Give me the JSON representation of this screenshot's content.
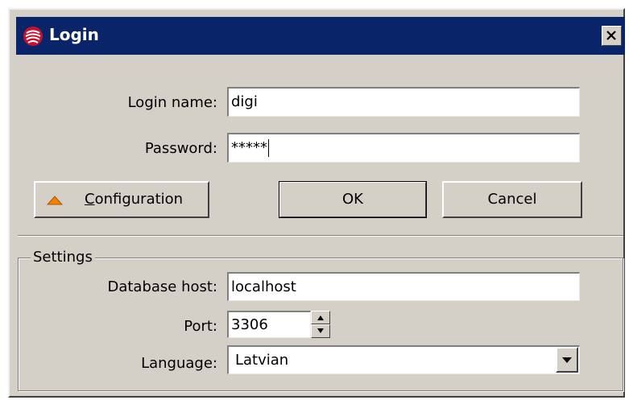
{
  "window": {
    "title": "Login",
    "close_symbol": "✕"
  },
  "login": {
    "login_name_label": "Login name:",
    "login_name_value": "digi",
    "password_label": "Password:",
    "password_value": "*****"
  },
  "buttons": {
    "configuration_prefix": "",
    "configuration_hotkey": "C",
    "configuration_rest": "onfiguration",
    "ok": "OK",
    "cancel": "Cancel"
  },
  "settings": {
    "group_label": "Settings",
    "db_host_label": "Database host:",
    "db_host_value": "localhost",
    "port_label": "Port:",
    "port_value": "3306",
    "language_label": "Language:",
    "language_value": "Latvian"
  },
  "icons": {
    "app": "app-logo-icon",
    "close": "close-icon",
    "configuration": "triangle-up-icon",
    "spin_up": "spin-up-icon",
    "spin_down": "spin-down-icon",
    "dropdown": "chevron-down-icon"
  },
  "colors": {
    "titlebar": "#0a246a",
    "face": "#d4d0c8",
    "config_icon": "#f08000"
  }
}
